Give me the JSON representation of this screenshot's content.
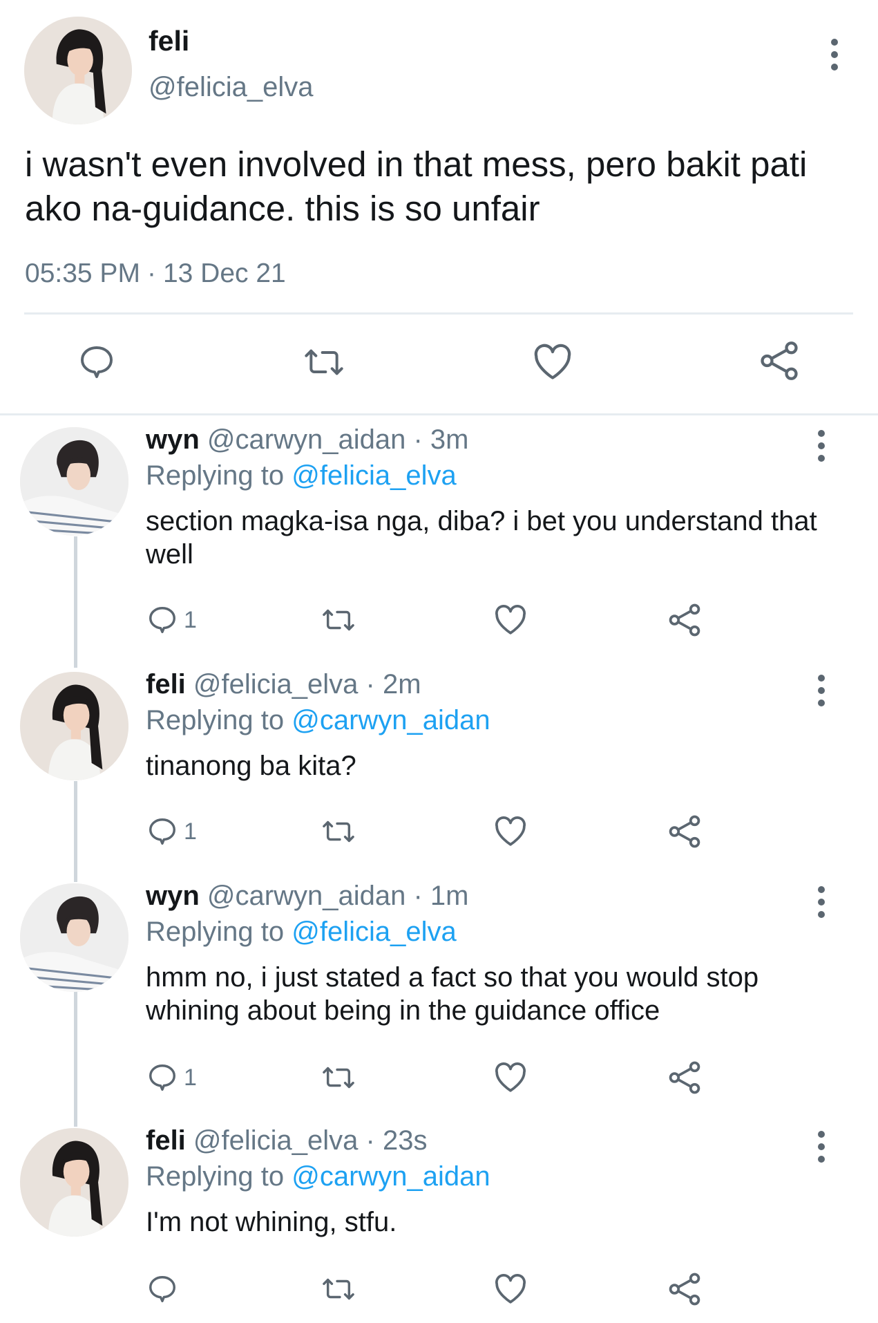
{
  "main_tweet": {
    "display_name": "feli",
    "handle": "@felicia_elva",
    "text": "i wasn't even involved in that mess, pero bakit pati ako na-guidance. this is so unfair",
    "time": "05:35 PM",
    "separator": "·",
    "date": "13 Dec 21",
    "actions": [
      "reply-icon",
      "retweet-icon",
      "like-icon",
      "share-icon"
    ]
  },
  "replies": [
    {
      "name": "wyn",
      "handle": "@carwyn_aidan",
      "time": "· 3m",
      "replying_label": "Replying to",
      "replying_to": "@felicia_elva",
      "text": "section magka-isa nga, diba? i bet you understand that well",
      "reply_count": "1"
    },
    {
      "name": "feli",
      "handle": "@felicia_elva",
      "time": "· 2m",
      "replying_label": "Replying to",
      "replying_to": "@carwyn_aidan",
      "text": "tinanong ba kita?",
      "reply_count": "1"
    },
    {
      "name": "wyn",
      "handle": "@carwyn_aidan",
      "time": "· 1m",
      "replying_label": "Replying to",
      "replying_to": "@felicia_elva",
      "text": "hmm no, i just stated a fact so that you would stop whining about being in the guidance office",
      "reply_count": "1"
    },
    {
      "name": "feli",
      "handle": "@felicia_elva",
      "time": "· 23s",
      "replying_label": "Replying to",
      "replying_to": "@carwyn_aidan",
      "text": "I'm not whining, stfu.",
      "reply_count": ""
    }
  ],
  "colors": {
    "text": "#14171a",
    "secondary": "#657786",
    "mention": "#1da1f2",
    "divider": "#e6ecf0",
    "icon": "#5b6670"
  }
}
